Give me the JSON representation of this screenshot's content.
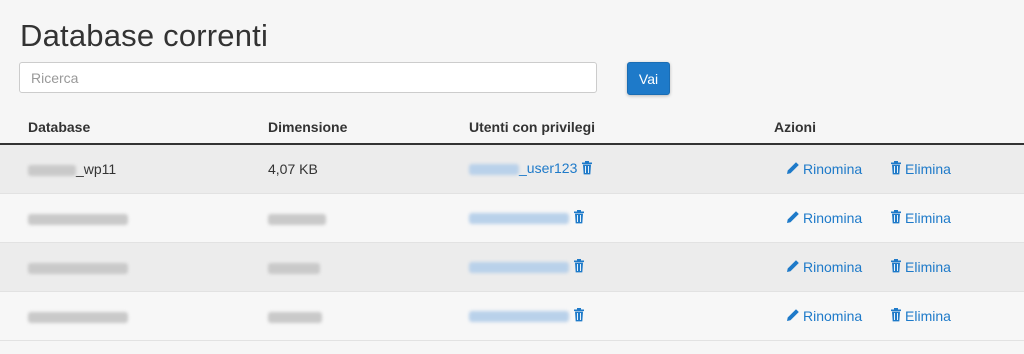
{
  "page": {
    "title": "Database correnti"
  },
  "search": {
    "placeholder": "Ricerca",
    "button_label": "Vai"
  },
  "table": {
    "headers": [
      "Database",
      "Dimensione",
      "Utenti con privilegi",
      "Azioni"
    ],
    "rows": [
      {
        "database_suffix": "_wp11",
        "size": "4,07 KB",
        "user_suffix": "_user123"
      },
      {
        "database_suffix": "",
        "size": "",
        "user_suffix": ""
      },
      {
        "database_suffix": "",
        "size": "",
        "user_suffix": ""
      },
      {
        "database_suffix": "",
        "size": "",
        "user_suffix": ""
      }
    ],
    "actions": {
      "rename": "Rinomina",
      "delete": "Elimina"
    }
  },
  "colors": {
    "accent": "#1e7ac9",
    "header_rule": "#333333"
  },
  "icons": {
    "rename": "pencil-icon",
    "delete": "trash-icon",
    "remove_user": "trash-icon"
  }
}
